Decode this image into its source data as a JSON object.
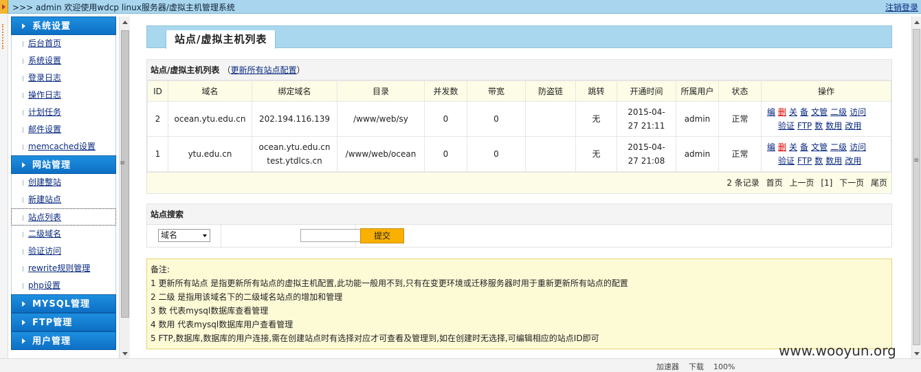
{
  "topbar": {
    "welcome": ">>> admin 欢迎使用wdcp linux服务器/虚拟主机管理系统",
    "logout": "注销登录"
  },
  "sidebar": {
    "sections": [
      {
        "title": "系统设置",
        "items": [
          "后台首页",
          "系统设置",
          "登录日志",
          "操作日志",
          "计划任务",
          "邮件设置",
          "memcached设置"
        ]
      },
      {
        "title": "网站管理",
        "items": [
          "创建整站",
          "新建站点",
          "站点列表",
          "二级域名",
          "验证访问",
          "rewrite规则管理",
          "php设置"
        ]
      },
      {
        "title": "MYSQL管理",
        "items": []
      },
      {
        "title": "FTP管理",
        "items": []
      },
      {
        "title": "用户管理",
        "items": []
      }
    ],
    "active_item": "站点列表"
  },
  "page": {
    "tab_title": "站点/虚拟主机列表"
  },
  "list": {
    "heading": "站点/虚拟主机列表",
    "refresh_link": "更新所有站点配置",
    "columns": [
      "ID",
      "域名",
      "绑定域名",
      "目录",
      "并发数",
      "带宽",
      "防盗链",
      "跳转",
      "开通时间",
      "所属用户",
      "状态",
      "操作"
    ],
    "rows": [
      {
        "id": "2",
        "domain": "ocean.ytu.edu.cn",
        "bind": [
          "202.194.116.139"
        ],
        "dir": "/www/web/sy",
        "conn": "0",
        "bw": "0",
        "hotlink": "",
        "redirect": "无",
        "time": [
          "2015-04-",
          "27 21:11"
        ],
        "user": "admin",
        "status": "正常"
      },
      {
        "id": "1",
        "domain": "ytu.edu.cn",
        "bind": [
          "ocean.ytu.edu.cn",
          "test.ytdlcs.cn"
        ],
        "dir": "/www/web/ocean",
        "conn": "0",
        "bw": "0",
        "hotlink": "",
        "redirect": "无",
        "time": [
          "2015-04-",
          "27 21:08"
        ],
        "user": "admin",
        "status": "正常"
      }
    ],
    "ops_line1": [
      "编",
      "删",
      "关",
      "备",
      "文管",
      "二级",
      "访问"
    ],
    "ops_line2": [
      "验证",
      "FTP",
      "数",
      "数用",
      "改用"
    ],
    "pager": {
      "count": "2 条记录",
      "first": "首页",
      "prev": "上一页",
      "current": "[1]",
      "next": "下一页",
      "last": "尾页"
    }
  },
  "search": {
    "heading": "站点搜索",
    "field_selected": "域名",
    "input_value": "",
    "submit": "提交"
  },
  "notes": {
    "lines": [
      "备注:",
      "1 更新所有站点 是指更新所有站点的虚拟主机配置,此功能一般用不到,只有在变更环境或迁移服务器时用于重新更新所有站点的配置",
      "2 二级 是指用该域名下的二级域名站点的增加和管理",
      "3 数 代表mysql数据库查看管理",
      "4 数用 代表mysql数据库用户查看管理",
      "5 FTP,数据库,数据库的用户连接,需在创建站点时有选择对应才可查看及管理到,如在创建时无选择,可编辑相应的站点ID即可"
    ]
  },
  "statusbar": {
    "items": [
      "加速器",
      "下载",
      "100%"
    ]
  },
  "watermark": "www.wooyun.org",
  "colors": {
    "topbar": "#a9d6ee",
    "sidebar_head": "#0d6fc4",
    "link": "#0a2a80",
    "delete": "#dd0000",
    "submit": "#f9b000",
    "notes_bg": "#fdfad6"
  }
}
